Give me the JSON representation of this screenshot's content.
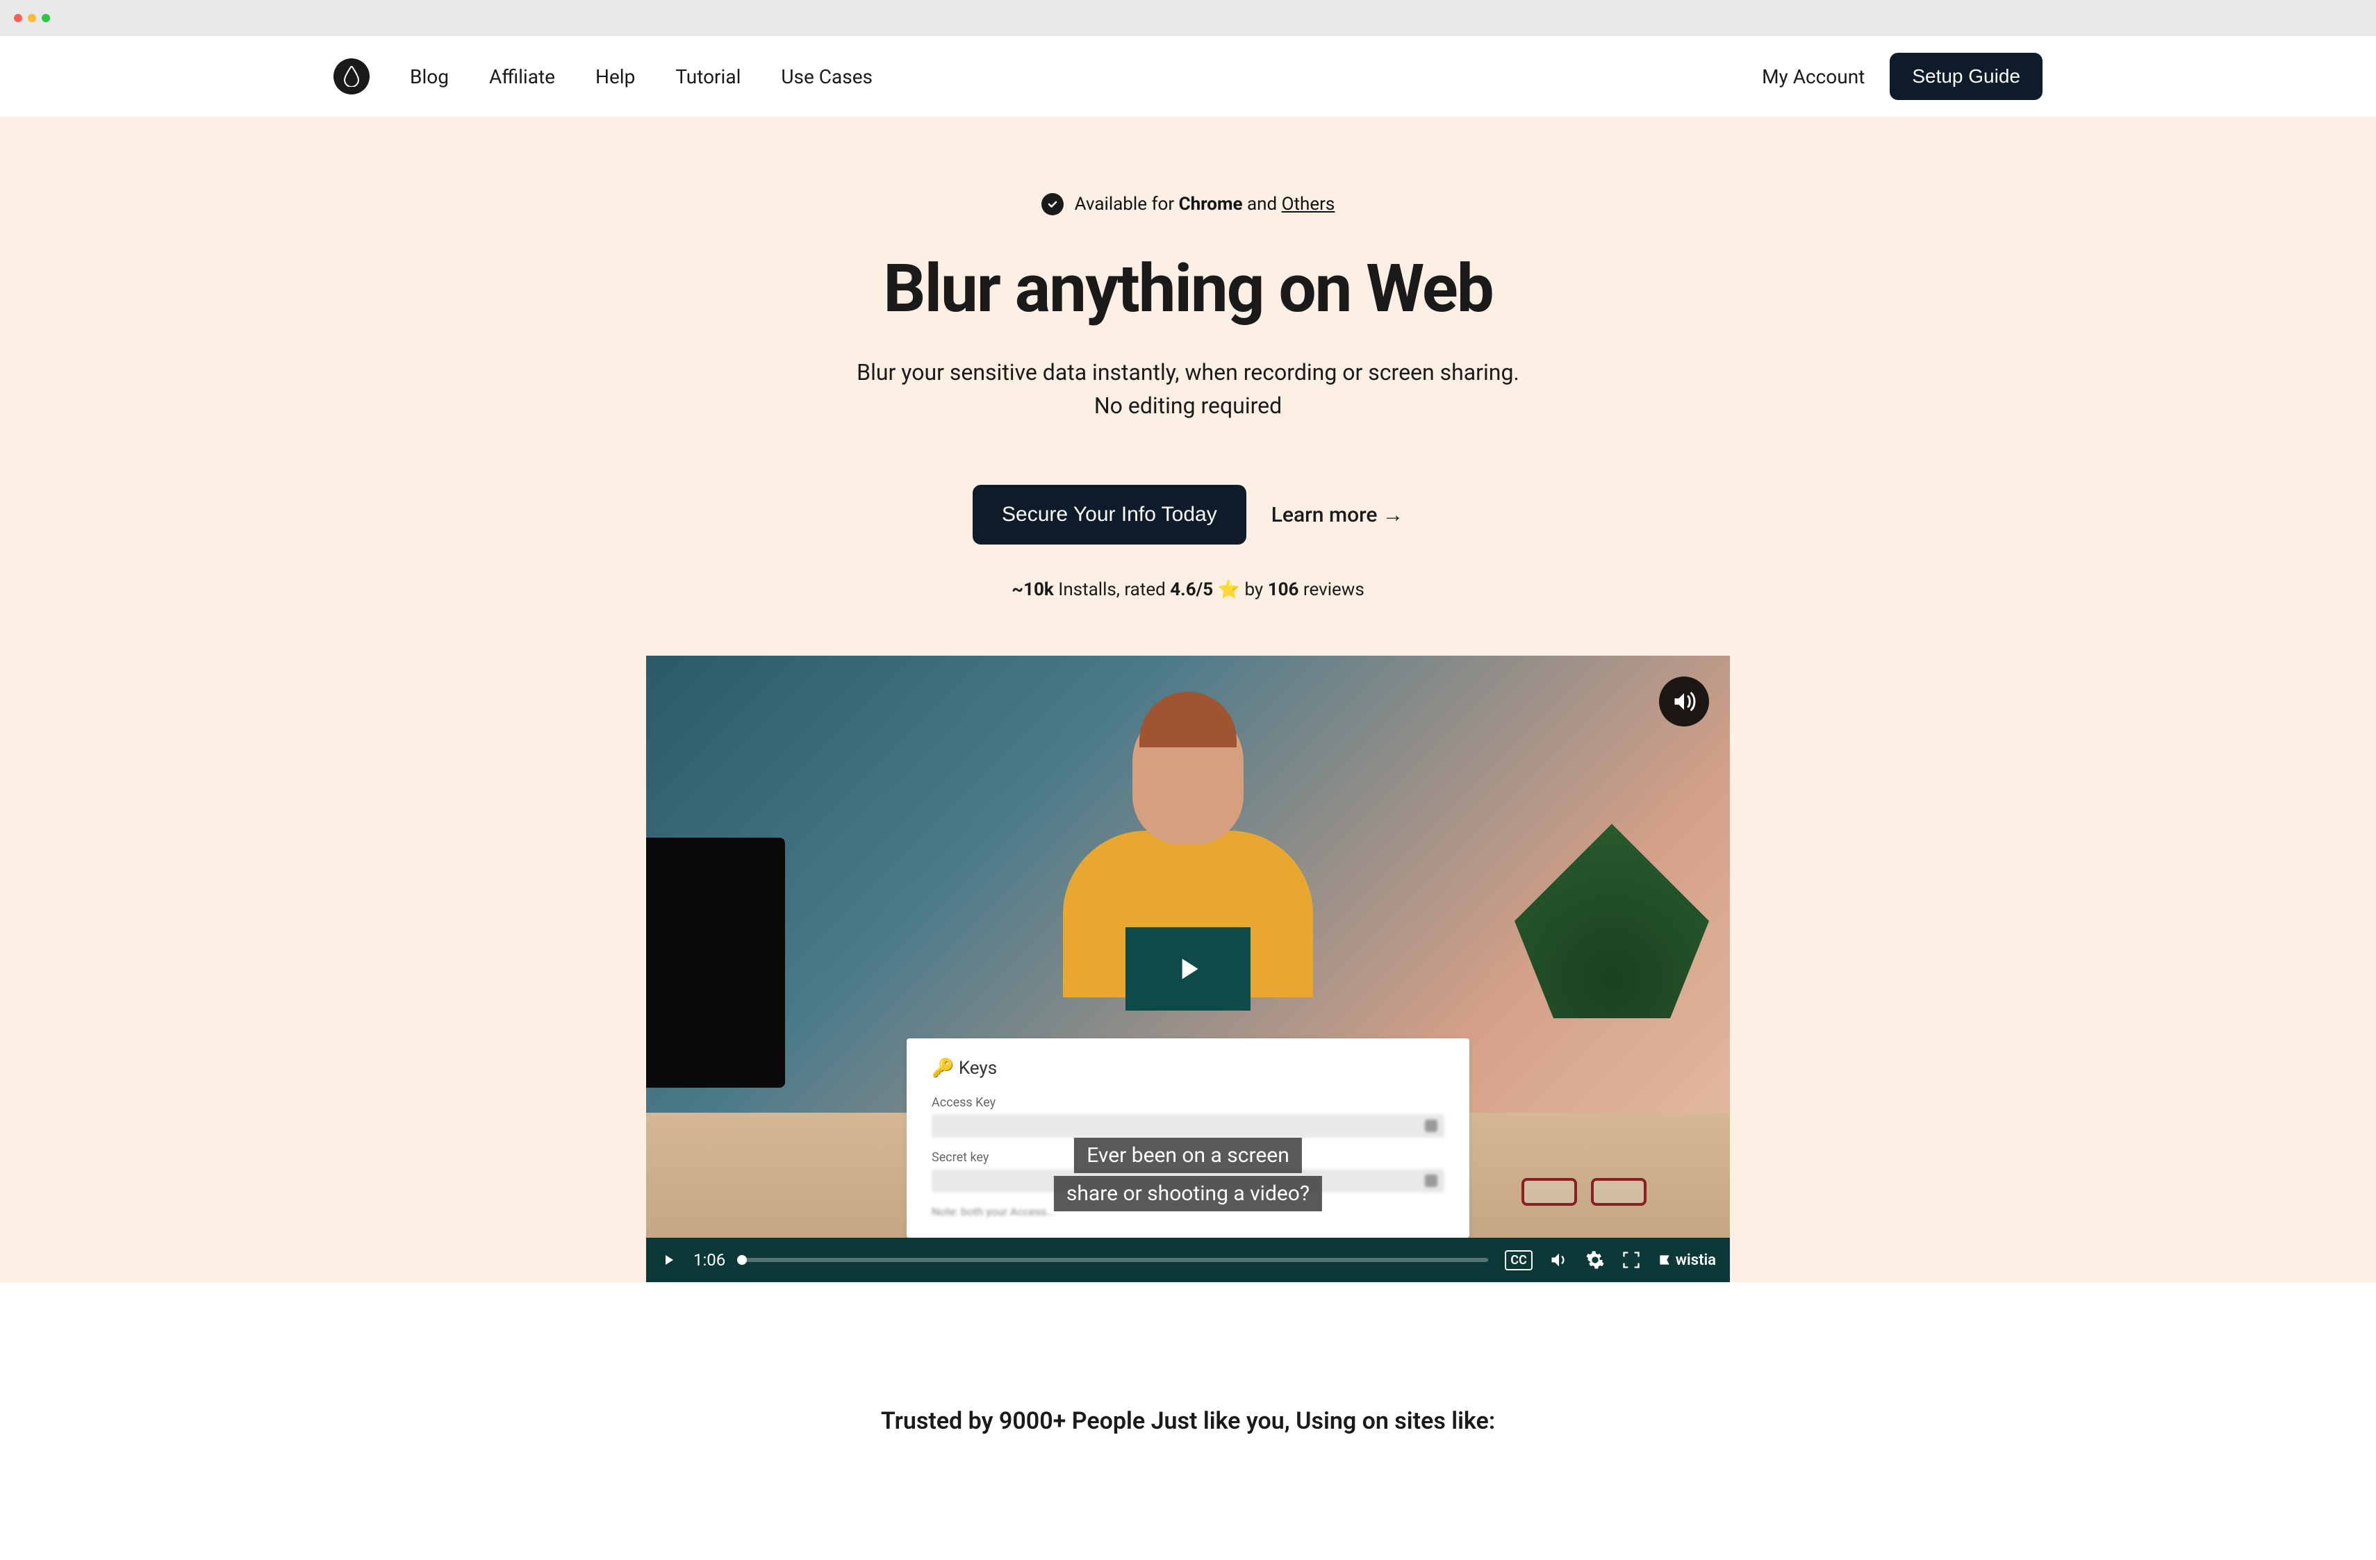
{
  "nav": {
    "links": [
      "Blog",
      "Affiliate",
      "Help",
      "Tutorial",
      "Use Cases"
    ],
    "my_account": "My Account",
    "setup_guide": "Setup Guide"
  },
  "hero": {
    "availability_prefix": "Available for ",
    "availability_chrome": "Chrome",
    "availability_and": " and ",
    "availability_others": "Others",
    "title": "Blur anything on Web",
    "subtitle_line1": "Blur your sensitive data instantly, when recording or screen sharing.",
    "subtitle_line2": "No editing required",
    "cta_primary": "Secure Your Info Today",
    "cta_secondary": "Learn more →",
    "stats_installs_num": "~10k",
    "stats_installs_text": " Installs, rated ",
    "stats_rating": "4.6/5",
    "stats_star": " ⭐ ",
    "stats_by": "by ",
    "stats_reviews_num": "106",
    "stats_reviews_text": " reviews"
  },
  "video": {
    "overlay": {
      "title": "🔑 Keys",
      "access_label": "Access Key",
      "secret_label": "Secret key",
      "note": "Note: both your Access..."
    },
    "caption_line1": "Ever been on a screen",
    "caption_line2": "share or shooting a video?",
    "time": "1:06",
    "cc_label": "CC",
    "wistia": "wistia"
  },
  "trusted": {
    "text": "Trusted by 9000+ People Just like you, Using on sites like:"
  }
}
